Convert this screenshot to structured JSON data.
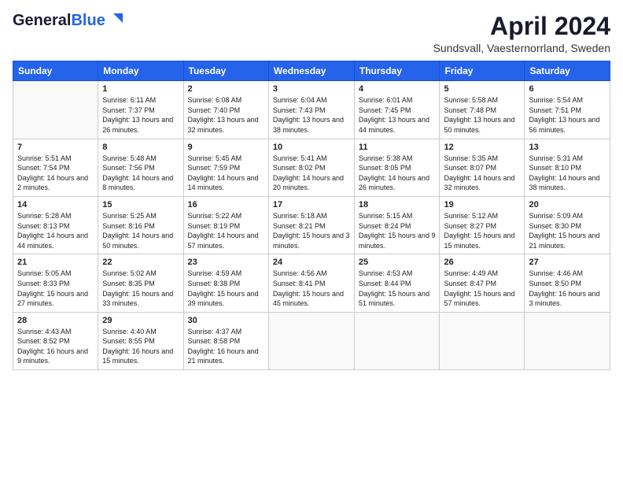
{
  "header": {
    "logo_line1": "General",
    "logo_line2": "Blue",
    "month": "April 2024",
    "location": "Sundsvall, Vaesternorrland, Sweden"
  },
  "days_of_week": [
    "Sunday",
    "Monday",
    "Tuesday",
    "Wednesday",
    "Thursday",
    "Friday",
    "Saturday"
  ],
  "weeks": [
    [
      {
        "num": "",
        "sunrise": "",
        "sunset": "",
        "daylight": ""
      },
      {
        "num": "1",
        "sunrise": "Sunrise: 6:11 AM",
        "sunset": "Sunset: 7:37 PM",
        "daylight": "Daylight: 13 hours and 26 minutes."
      },
      {
        "num": "2",
        "sunrise": "Sunrise: 6:08 AM",
        "sunset": "Sunset: 7:40 PM",
        "daylight": "Daylight: 13 hours and 32 minutes."
      },
      {
        "num": "3",
        "sunrise": "Sunrise: 6:04 AM",
        "sunset": "Sunset: 7:43 PM",
        "daylight": "Daylight: 13 hours and 38 minutes."
      },
      {
        "num": "4",
        "sunrise": "Sunrise: 6:01 AM",
        "sunset": "Sunset: 7:45 PM",
        "daylight": "Daylight: 13 hours and 44 minutes."
      },
      {
        "num": "5",
        "sunrise": "Sunrise: 5:58 AM",
        "sunset": "Sunset: 7:48 PM",
        "daylight": "Daylight: 13 hours and 50 minutes."
      },
      {
        "num": "6",
        "sunrise": "Sunrise: 5:54 AM",
        "sunset": "Sunset: 7:51 PM",
        "daylight": "Daylight: 13 hours and 56 minutes."
      }
    ],
    [
      {
        "num": "7",
        "sunrise": "Sunrise: 5:51 AM",
        "sunset": "Sunset: 7:54 PM",
        "daylight": "Daylight: 14 hours and 2 minutes."
      },
      {
        "num": "8",
        "sunrise": "Sunrise: 5:48 AM",
        "sunset": "Sunset: 7:56 PM",
        "daylight": "Daylight: 14 hours and 8 minutes."
      },
      {
        "num": "9",
        "sunrise": "Sunrise: 5:45 AM",
        "sunset": "Sunset: 7:59 PM",
        "daylight": "Daylight: 14 hours and 14 minutes."
      },
      {
        "num": "10",
        "sunrise": "Sunrise: 5:41 AM",
        "sunset": "Sunset: 8:02 PM",
        "daylight": "Daylight: 14 hours and 20 minutes."
      },
      {
        "num": "11",
        "sunrise": "Sunrise: 5:38 AM",
        "sunset": "Sunset: 8:05 PM",
        "daylight": "Daylight: 14 hours and 26 minutes."
      },
      {
        "num": "12",
        "sunrise": "Sunrise: 5:35 AM",
        "sunset": "Sunset: 8:07 PM",
        "daylight": "Daylight: 14 hours and 32 minutes."
      },
      {
        "num": "13",
        "sunrise": "Sunrise: 5:31 AM",
        "sunset": "Sunset: 8:10 PM",
        "daylight": "Daylight: 14 hours and 38 minutes."
      }
    ],
    [
      {
        "num": "14",
        "sunrise": "Sunrise: 5:28 AM",
        "sunset": "Sunset: 8:13 PM",
        "daylight": "Daylight: 14 hours and 44 minutes."
      },
      {
        "num": "15",
        "sunrise": "Sunrise: 5:25 AM",
        "sunset": "Sunset: 8:16 PM",
        "daylight": "Daylight: 14 hours and 50 minutes."
      },
      {
        "num": "16",
        "sunrise": "Sunrise: 5:22 AM",
        "sunset": "Sunset: 8:19 PM",
        "daylight": "Daylight: 14 hours and 57 minutes."
      },
      {
        "num": "17",
        "sunrise": "Sunrise: 5:18 AM",
        "sunset": "Sunset: 8:21 PM",
        "daylight": "Daylight: 15 hours and 3 minutes."
      },
      {
        "num": "18",
        "sunrise": "Sunrise: 5:15 AM",
        "sunset": "Sunset: 8:24 PM",
        "daylight": "Daylight: 15 hours and 9 minutes."
      },
      {
        "num": "19",
        "sunrise": "Sunrise: 5:12 AM",
        "sunset": "Sunset: 8:27 PM",
        "daylight": "Daylight: 15 hours and 15 minutes."
      },
      {
        "num": "20",
        "sunrise": "Sunrise: 5:09 AM",
        "sunset": "Sunset: 8:30 PM",
        "daylight": "Daylight: 15 hours and 21 minutes."
      }
    ],
    [
      {
        "num": "21",
        "sunrise": "Sunrise: 5:05 AM",
        "sunset": "Sunset: 8:33 PM",
        "daylight": "Daylight: 15 hours and 27 minutes."
      },
      {
        "num": "22",
        "sunrise": "Sunrise: 5:02 AM",
        "sunset": "Sunset: 8:35 PM",
        "daylight": "Daylight: 15 hours and 33 minutes."
      },
      {
        "num": "23",
        "sunrise": "Sunrise: 4:59 AM",
        "sunset": "Sunset: 8:38 PM",
        "daylight": "Daylight: 15 hours and 39 minutes."
      },
      {
        "num": "24",
        "sunrise": "Sunrise: 4:56 AM",
        "sunset": "Sunset: 8:41 PM",
        "daylight": "Daylight: 15 hours and 45 minutes."
      },
      {
        "num": "25",
        "sunrise": "Sunrise: 4:53 AM",
        "sunset": "Sunset: 8:44 PM",
        "daylight": "Daylight: 15 hours and 51 minutes."
      },
      {
        "num": "26",
        "sunrise": "Sunrise: 4:49 AM",
        "sunset": "Sunset: 8:47 PM",
        "daylight": "Daylight: 15 hours and 57 minutes."
      },
      {
        "num": "27",
        "sunrise": "Sunrise: 4:46 AM",
        "sunset": "Sunset: 8:50 PM",
        "daylight": "Daylight: 16 hours and 3 minutes."
      }
    ],
    [
      {
        "num": "28",
        "sunrise": "Sunrise: 4:43 AM",
        "sunset": "Sunset: 8:52 PM",
        "daylight": "Daylight: 16 hours and 9 minutes."
      },
      {
        "num": "29",
        "sunrise": "Sunrise: 4:40 AM",
        "sunset": "Sunset: 8:55 PM",
        "daylight": "Daylight: 16 hours and 15 minutes."
      },
      {
        "num": "30",
        "sunrise": "Sunrise: 4:37 AM",
        "sunset": "Sunset: 8:58 PM",
        "daylight": "Daylight: 16 hours and 21 minutes."
      },
      {
        "num": "",
        "sunrise": "",
        "sunset": "",
        "daylight": ""
      },
      {
        "num": "",
        "sunrise": "",
        "sunset": "",
        "daylight": ""
      },
      {
        "num": "",
        "sunrise": "",
        "sunset": "",
        "daylight": ""
      },
      {
        "num": "",
        "sunrise": "",
        "sunset": "",
        "daylight": ""
      }
    ]
  ]
}
